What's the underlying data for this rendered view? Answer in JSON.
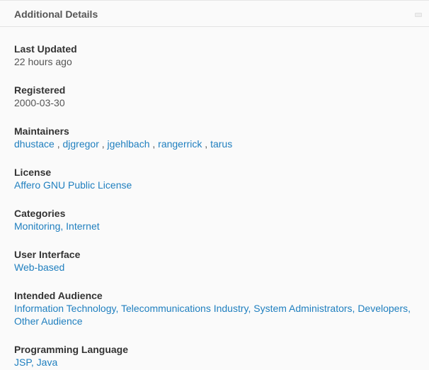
{
  "panel": {
    "title": "Additional Details",
    "collapse_icon": "minus-icon"
  },
  "colors": {
    "link": "#1f7fbf",
    "label": "#333333",
    "text": "#555555",
    "background": "#fafafa"
  },
  "fields": {
    "last_updated": {
      "label": "Last Updated",
      "value": "22 hours ago"
    },
    "registered": {
      "label": "Registered",
      "value": "2000-03-30"
    },
    "maintainers": {
      "label": "Maintainers",
      "items": [
        "dhustace",
        "djgregor",
        "jgehlbach",
        "rangerrick",
        "tarus"
      ],
      "separator": " , "
    },
    "license": {
      "label": "License",
      "items": [
        "Affero GNU Public License"
      ]
    },
    "categories": {
      "label": "Categories",
      "items": [
        "Monitoring",
        "Internet"
      ],
      "separator": ", "
    },
    "user_interface": {
      "label": "User Interface",
      "items": [
        "Web-based"
      ]
    },
    "intended_audience": {
      "label": "Intended Audience",
      "items": [
        "Information Technology",
        "Telecommunications Industry",
        "System Administrators",
        "Developers",
        "Other Audience"
      ],
      "separator": ", "
    },
    "programming_language": {
      "label": "Programming Language",
      "items": [
        "JSP",
        "Java"
      ],
      "separator": ", "
    }
  }
}
